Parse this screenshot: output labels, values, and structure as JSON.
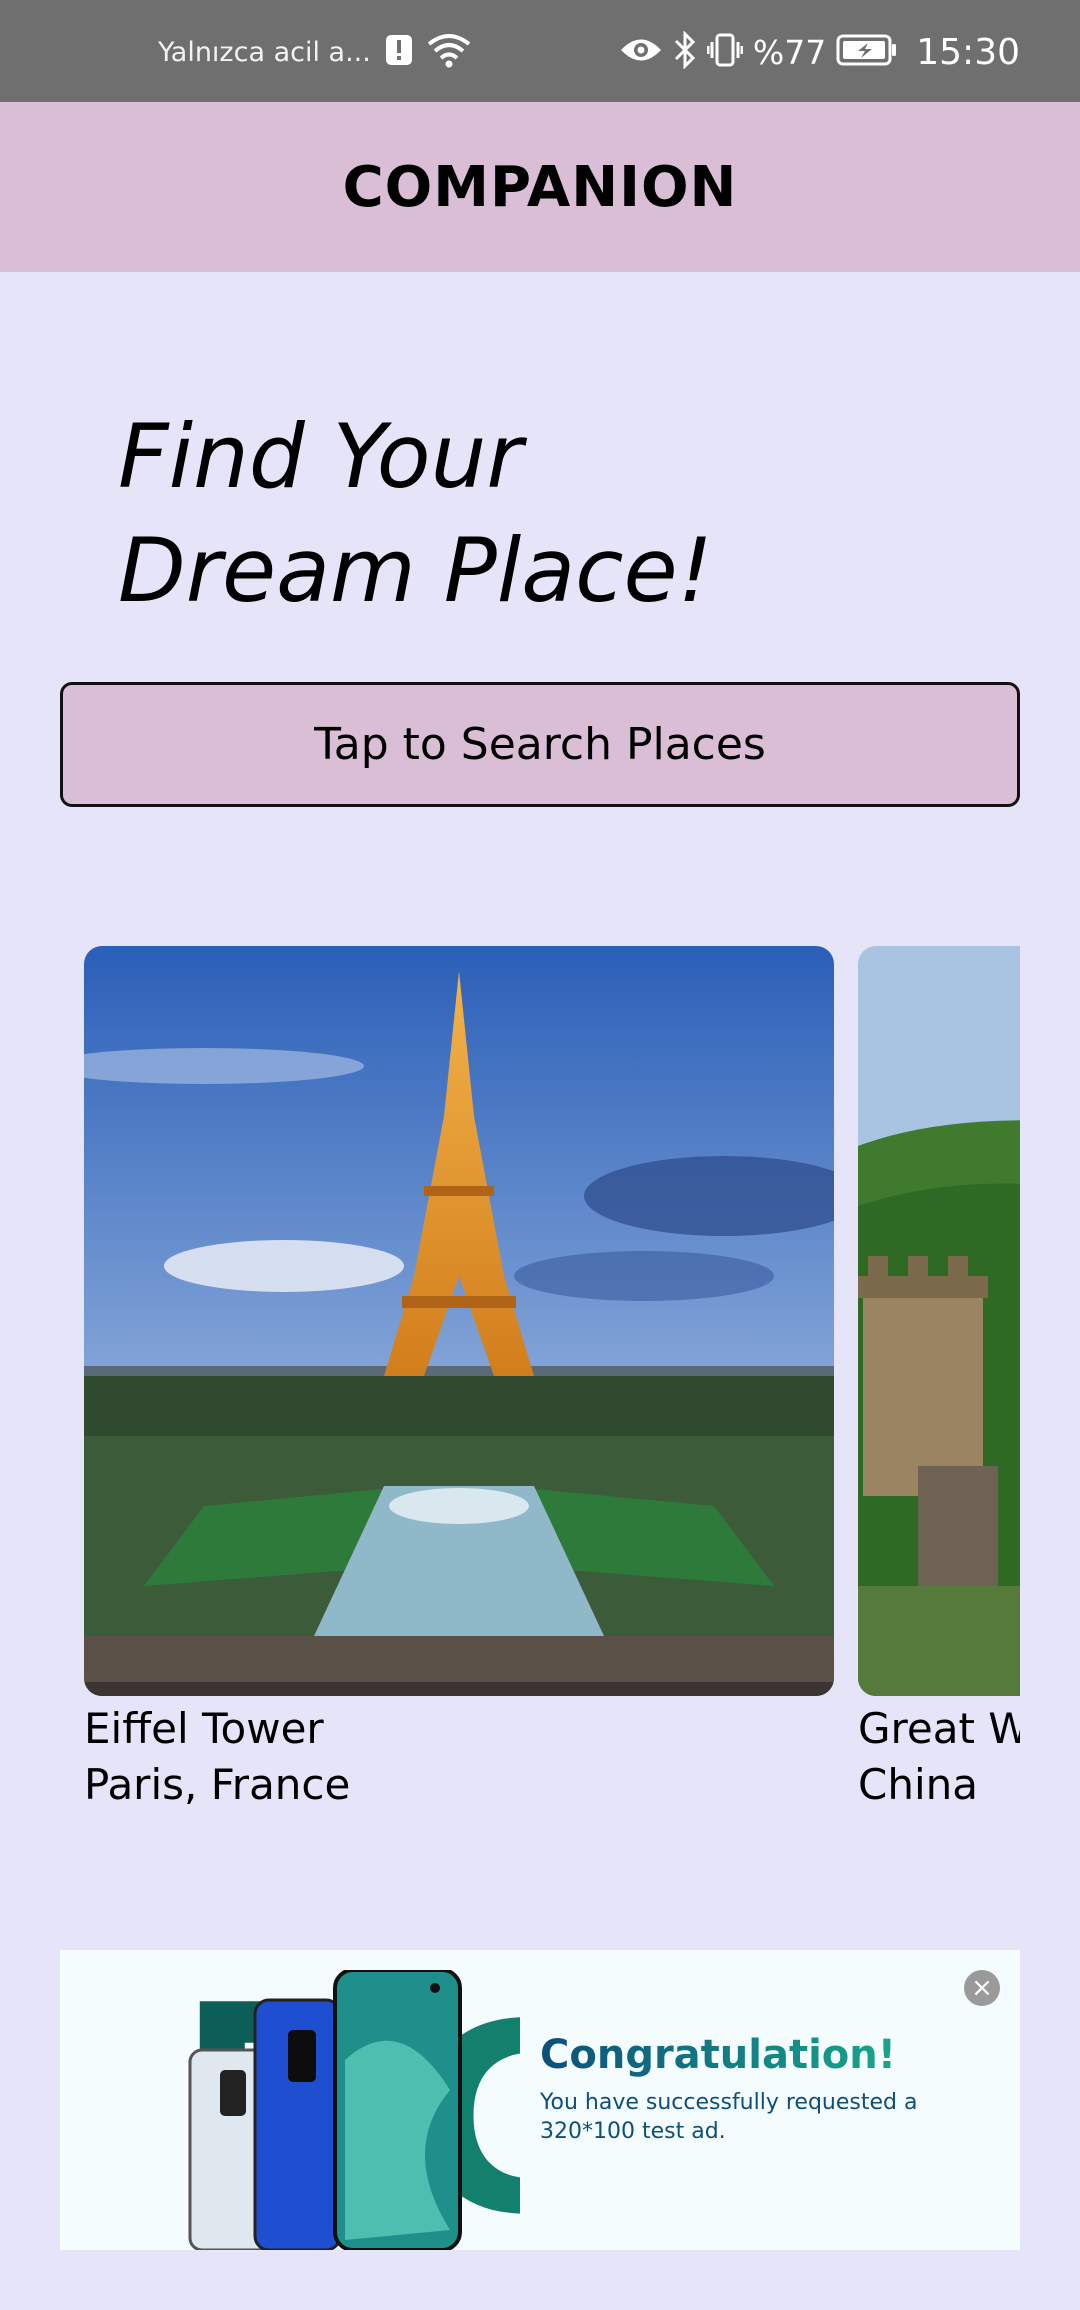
{
  "status_bar": {
    "carrier_text": "Yalnızca acil a...",
    "battery_percent": "%77",
    "time": "15:30",
    "icons": [
      "alert-icon",
      "wifi-icon",
      "eye-icon",
      "bluetooth-icon",
      "vibrate-icon",
      "battery-icon"
    ]
  },
  "app_bar": {
    "title": "COMPANION"
  },
  "hero": {
    "line1": "Find Your",
    "line2": "Dream Place!"
  },
  "search_button": {
    "label": "Tap to Search Places"
  },
  "places": [
    {
      "name": "Eiffel Tower",
      "location": "Paris, France"
    },
    {
      "name": "Great Wall",
      "location": "China"
    }
  ],
  "ad": {
    "headline": "Congratulation!",
    "body": "You have successfully requested a 320*100 test ad.",
    "close_label": "×"
  },
  "colors": {
    "status_bar": "#6f6f6f",
    "app_bar": "#d9bed6",
    "background": "#e6e4f8",
    "button": "#d9bed6"
  }
}
